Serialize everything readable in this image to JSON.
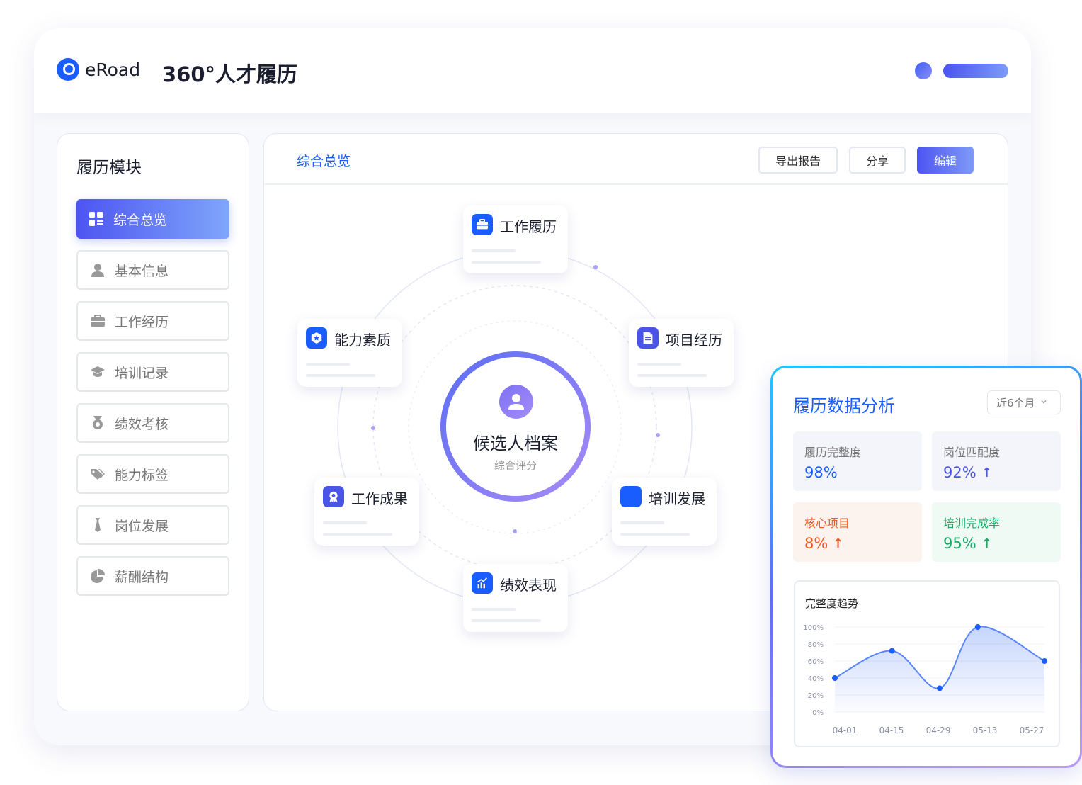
{
  "brand": {
    "name": "eRoad",
    "app_title": "360°人才履历"
  },
  "sidebar": {
    "title": "履历模块",
    "items": [
      {
        "label": "综合总览",
        "icon": "grid-icon",
        "active": true
      },
      {
        "label": "基本信息",
        "icon": "user-icon"
      },
      {
        "label": "工作经历",
        "icon": "briefcase-icon"
      },
      {
        "label": "培训记录",
        "icon": "graduation-cap-icon"
      },
      {
        "label": "绩效考核",
        "icon": "medal-icon"
      },
      {
        "label": "能力标签",
        "icon": "tags-icon"
      },
      {
        "label": "岗位发展",
        "icon": "tie-icon"
      },
      {
        "label": "薪酬结构",
        "icon": "pie-icon"
      }
    ]
  },
  "main": {
    "title": "综合总览",
    "buttons": {
      "export": "导出报告",
      "share": "分享",
      "edit": "编辑"
    },
    "center": {
      "name": "候选人档案",
      "sub": "综合评分"
    },
    "cards": [
      {
        "label": "工作履历",
        "icon": "briefcase-icon"
      },
      {
        "label": "项目经历",
        "icon": "document-icon"
      },
      {
        "label": "培训发展",
        "icon": "square-icon"
      },
      {
        "label": "绩效表现",
        "icon": "chart-icon"
      },
      {
        "label": "工作成果",
        "icon": "award-icon"
      },
      {
        "label": "能力素质",
        "icon": "star-badge-icon"
      }
    ]
  },
  "analysis": {
    "title": "履历数据分析",
    "range": "近6个月",
    "stats": [
      {
        "label": "履历完整度",
        "value": "98%",
        "color": "#1a5dff",
        "bg": "#f4f5fb",
        "arrow": ""
      },
      {
        "label": "岗位匹配度",
        "value": "92%",
        "color": "#4a55e8",
        "bg": "#f4f5fb",
        "arrow": "up"
      },
      {
        "label": "核心项目",
        "value": "8%",
        "color": "#f05a1e",
        "bg": "#fdf3ee",
        "arrow": "up"
      },
      {
        "label": "培训完成率",
        "value": "95%",
        "color": "#17a864",
        "bg": "#eefaf3",
        "arrow": "up"
      }
    ],
    "trend_title": "完整度趋势"
  },
  "chart_data": {
    "type": "area",
    "title": "完整度趋势",
    "categories": [
      "04-01",
      "04-15",
      "04-29",
      "05-13",
      "05-27"
    ],
    "x": [
      0,
      1,
      2,
      3,
      4
    ],
    "point_x": [
      0,
      1.2,
      2.2,
      3.0,
      4.4
    ],
    "values": [
      40,
      72,
      28,
      100,
      60
    ],
    "ylim": [
      0,
      100
    ],
    "yticks": [
      "0%",
      "20%",
      "40%",
      "60%",
      "80%",
      "100%"
    ],
    "grid": true,
    "color": "#1a5dff"
  }
}
